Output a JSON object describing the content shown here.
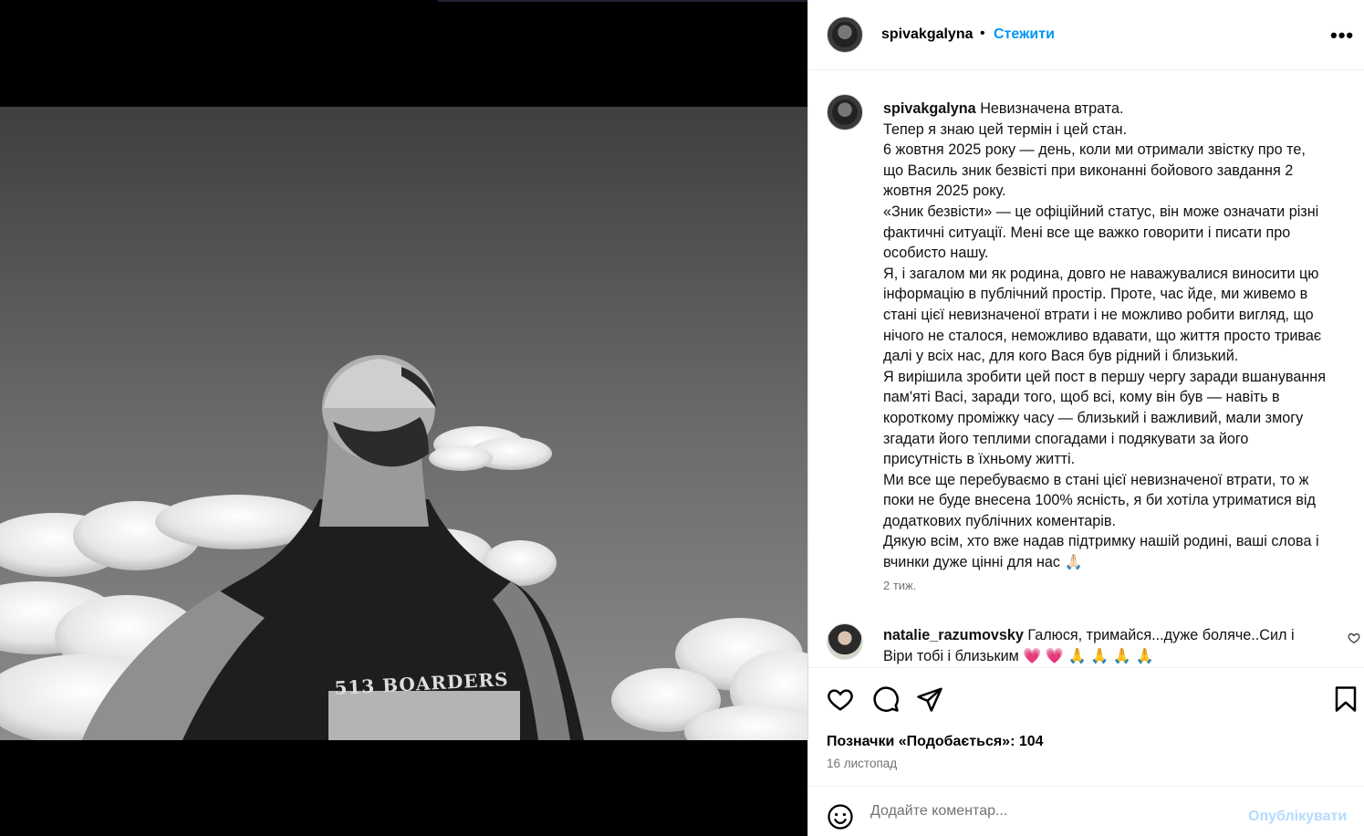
{
  "post": {
    "username": "spivakgalyna",
    "dot": "•",
    "follow_label": "Стежити",
    "more_label": "•••"
  },
  "photo": {
    "shirt_text": "513 BOARDERS"
  },
  "caption": {
    "username": "spivakgalyna",
    "lines": [
      "Невизначена втрата.",
      "Тепер я знаю цей термін і цей стан.",
      "6 жовтня 2025 року — день, коли ми отримали звістку про те,",
      "що Василь зник безвісті при виконанні бойового завдання 2",
      "жовтня 2025 року.",
      "«Зник безвісти» — це офіційний статус, він може означати різні",
      "фактичні ситуації. Мені все ще важко говорити і писати про",
      "особисто нашу.",
      "Я, і загалом ми як родина, довго не наважувалися виносити цю",
      "інформацію в публічний простір. Проте, час йде, ми живемо в",
      "стані цієї невизначеної втрати і не можливо робити вигляд, що",
      "нічого не сталося, неможливо вдавати, що життя просто триває",
      "далі у всіх нас, для кого Вася був рідний і близький.",
      "Я вирішила зробити цей пост в першу чергу заради вшанування",
      "пам'яті Васі, заради того, щоб всі, кому він був — навіть в",
      "короткому проміжку часу — близький і важливий, мали змогу",
      "згадати його теплими спогадами і подякувати за його",
      "присутність в їхньому житті.",
      "Ми все ще перебуваємо в стані цієї невизначеної втрати, то ж",
      "поки не буде внесена 100% ясність, я би хотіла утриматися від",
      "додаткових публічних коментарів.",
      "Дякую всім, хто вже надав підтримку нашій родині, ваші слова і",
      "вчинки дуже цінні для нас 🙏🏻"
    ],
    "time": "2 тиж."
  },
  "comment": {
    "username": "natalie_razumovsky",
    "line1": "Галюся, тримайся...дуже боляче..Сил і",
    "line2": "Віри тобі і близьким 💗 💗 🙏 🙏 🙏 🙏"
  },
  "stats": {
    "likes": "Позначки «Подобається»: 104",
    "date": "16 листопад"
  },
  "add_comment": {
    "placeholder": "Додайте коментар...",
    "post_label": "Опублікувати"
  }
}
